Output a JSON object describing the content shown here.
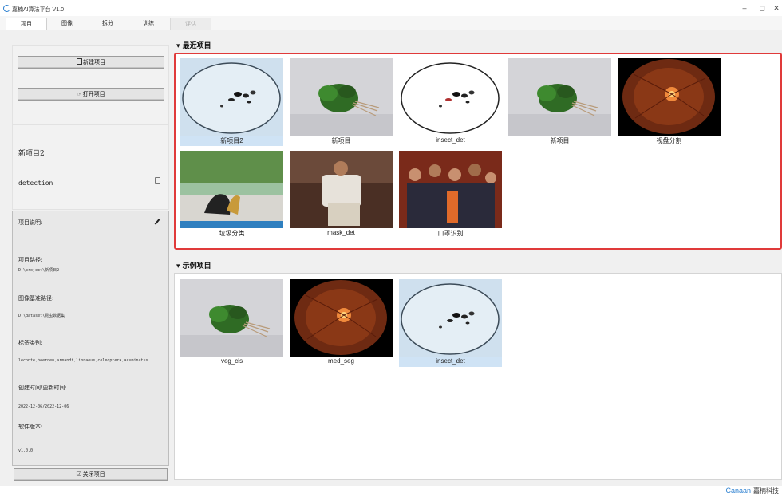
{
  "window": {
    "title": "嘉楠AI算法平台 V1.0",
    "minimize": "–",
    "maximize": "◻",
    "close": "✕"
  },
  "tabs": [
    {
      "label": "项目",
      "state": "active"
    },
    {
      "label": "图像",
      "state": "normal"
    },
    {
      "label": "拆分",
      "state": "normal"
    },
    {
      "label": "训练",
      "state": "normal"
    },
    {
      "label": "评估",
      "state": "disabled"
    }
  ],
  "sidebar": {
    "new_project": "新建项目",
    "open_project": "打开项目",
    "project_name": "新项目2",
    "project_type": "detection",
    "desc_label": "项目说明:",
    "path_label": "项目路径:",
    "path_value": "D:\\project\\新项目2",
    "image_root_label": "图像基准路径:",
    "image_root_value": "D:\\dataset\\昆虫数据集",
    "labels_label": "标签类别:",
    "labels_value": "leconte,boernen,armandi,linnaeus,coleoptera,acuminatus",
    "time_label": "创建时间/更新时间:",
    "time_value": "2022-12-06/2022-12-06",
    "version_label": "软件版本:",
    "version_value": "v1.0.0",
    "close_project": "关闭项目"
  },
  "recent": {
    "title": "最近项目",
    "items": [
      {
        "label": "新项目2",
        "thumb": "insect-thumb",
        "selected": true
      },
      {
        "label": "新项目",
        "thumb": "vegetable-thumb",
        "selected": false
      },
      {
        "label": "insect_det",
        "thumb": "insect-thumb-white",
        "selected": false
      },
      {
        "label": "新项目",
        "thumb": "vegetable-thumb",
        "selected": false
      },
      {
        "label": "视盘分割",
        "thumb": "retina-thumb",
        "selected": false
      },
      {
        "label": "垃圾分类",
        "thumb": "trash-thumb",
        "selected": false
      },
      {
        "label": "mask_det",
        "thumb": "person-sofa-thumb",
        "selected": false
      },
      {
        "label": "口罩识别",
        "thumb": "crowd-thumb",
        "selected": false
      }
    ]
  },
  "examples": {
    "title": "示例项目",
    "items": [
      {
        "label": "veg_cls",
        "thumb": "vegetable-thumb",
        "selected": false
      },
      {
        "label": "med_seg",
        "thumb": "retina-thumb",
        "selected": false
      },
      {
        "label": "insect_det",
        "thumb": "insect-thumb",
        "selected": true
      }
    ]
  },
  "footer": {
    "brand": "Canaan",
    "brand_cn": "嘉楠科技"
  }
}
